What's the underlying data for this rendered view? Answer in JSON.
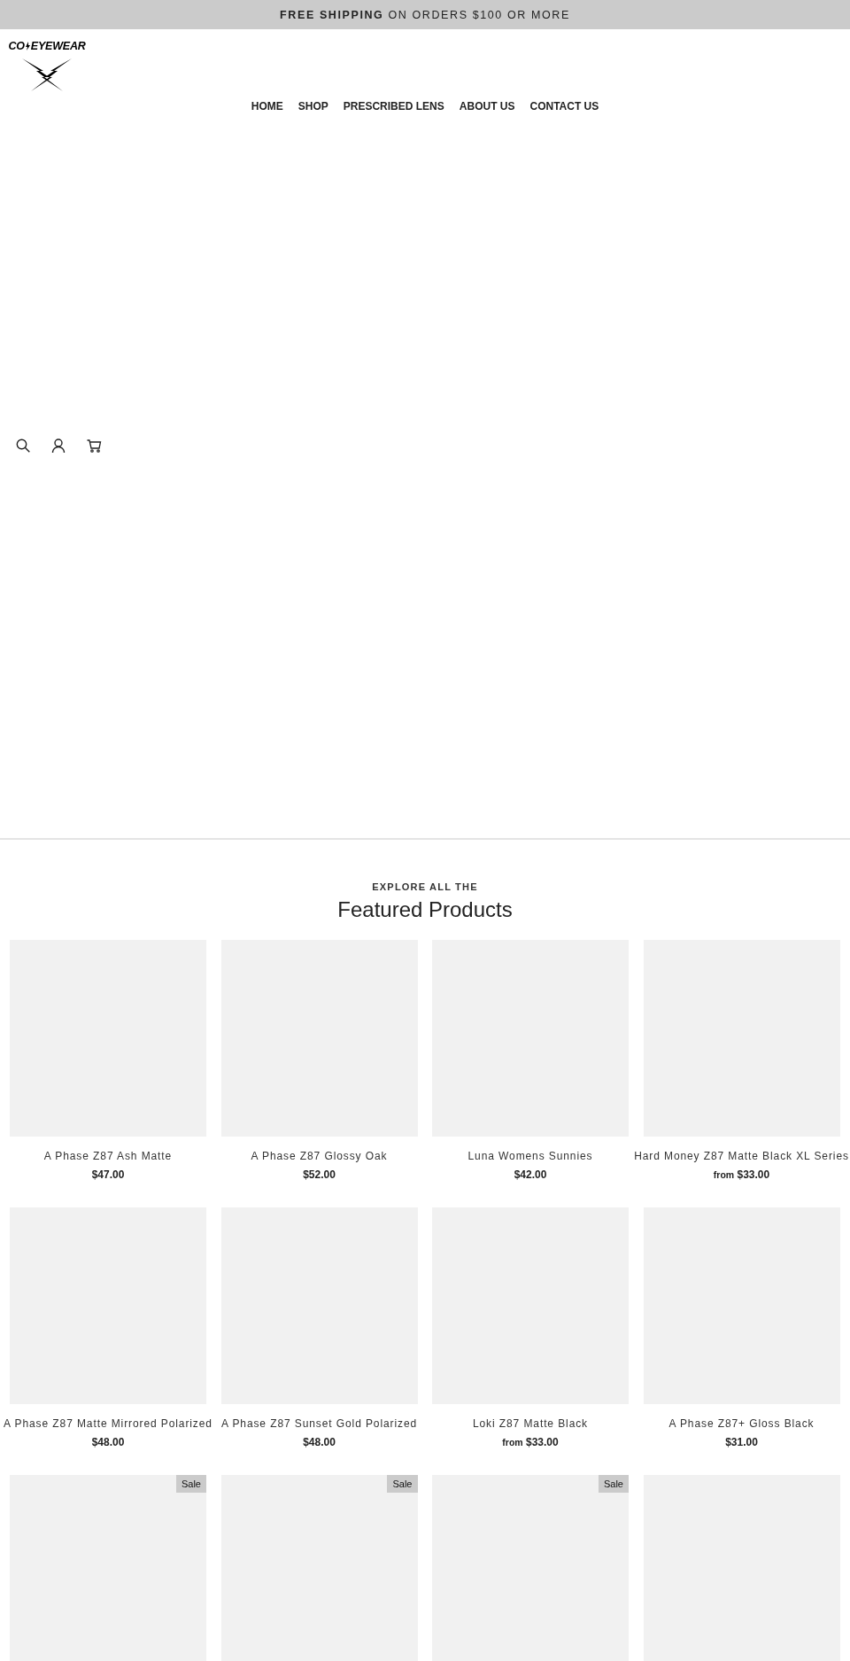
{
  "announcement": {
    "bold": "FREE SHIPPING",
    "rest": "ON ORDERS $100 OR MORE"
  },
  "logo": {
    "left": "CO",
    "right": "EYEWEAR"
  },
  "nav": [
    {
      "label": "HOME"
    },
    {
      "label": "SHOP"
    },
    {
      "label": "PRESCRIBED LENS"
    },
    {
      "label": "ABOUT US"
    },
    {
      "label": "CONTACT US"
    }
  ],
  "header_icons": [
    {
      "kind": "search"
    },
    {
      "kind": "account"
    },
    {
      "kind": "cart"
    }
  ],
  "featured": {
    "eyebrow": "EXPLORE ALL THE",
    "title": "Featured Products"
  },
  "products": [
    {
      "title": "A Phase Z87 Ash Matte",
      "price": "$47.00"
    },
    {
      "title": "A Phase Z87 Glossy Oak",
      "price": "$52.00"
    },
    {
      "title": "Luna Womens Sunnies",
      "price": "$42.00"
    },
    {
      "title": "Hard Money Z87 Matte Black XL Series",
      "price_prefix": "from",
      "price": "$33.00"
    },
    {
      "title": "A Phase Z87 Matte Mirrored Polarized",
      "price": "$48.00"
    },
    {
      "title": "A Phase Z87 Sunset Gold Polarized",
      "price": "$48.00"
    },
    {
      "title": "Loki Z87 Matte Black",
      "price_prefix": "from",
      "price": "$33.00"
    },
    {
      "title": "A Phase Z87+ Gloss Black",
      "price": "$31.00"
    },
    {
      "kind": "sale",
      "badge": "Sale"
    },
    {
      "kind": "sale",
      "badge": "Sale"
    },
    {
      "kind": "sale",
      "badge": "Sale"
    },
    {
      "kind": "plain"
    }
  ]
}
